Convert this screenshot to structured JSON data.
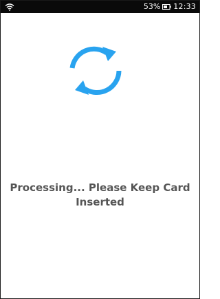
{
  "status_bar": {
    "battery_percent": "53%",
    "time": "12:33"
  },
  "icons": {
    "wifi": "wifi-icon",
    "battery": "battery-icon",
    "spinner": "refresh-sync-icon"
  },
  "colors": {
    "spinner": "#29a3ef",
    "message_text": "#555555",
    "status_bar_bg": "#0a0a0a"
  },
  "main": {
    "message_line1": "Processing... Please Keep Card",
    "message_line2": "Inserted"
  }
}
